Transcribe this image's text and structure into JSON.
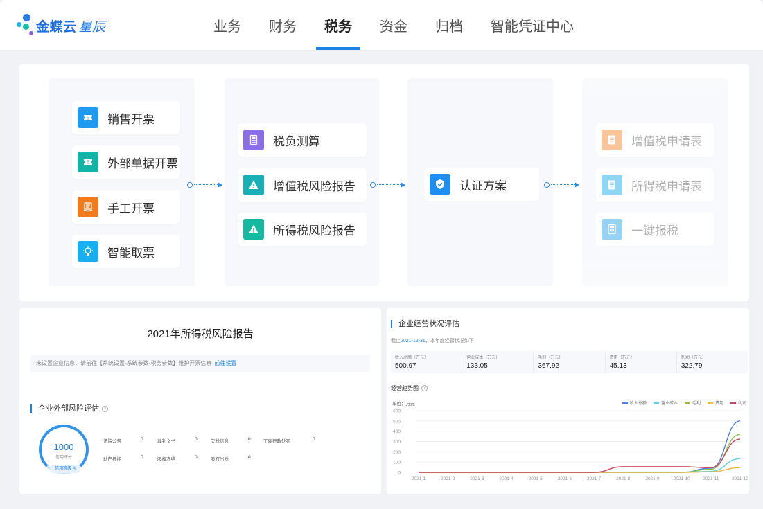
{
  "brand": {
    "name": "金蝶云",
    "suffix": "星辰"
  },
  "nav": [
    {
      "label": "业务",
      "active": false
    },
    {
      "label": "财务",
      "active": false
    },
    {
      "label": "税务",
      "active": true
    },
    {
      "label": "资金",
      "active": false
    },
    {
      "label": "归档",
      "active": false
    },
    {
      "label": "智能凭证中心",
      "active": false
    }
  ],
  "flow": {
    "col1": [
      {
        "label": "销售开票",
        "icon": "ticket-icon",
        "color": "#1e9af1"
      },
      {
        "label": "外部单据开票",
        "icon": "ticket-icon",
        "color": "#13b4a8"
      },
      {
        "label": "手工开票",
        "icon": "hand-invoice-icon",
        "color": "#f27a1a"
      },
      {
        "label": "智能取票",
        "icon": "lightbulb-icon",
        "color": "#18aff0"
      }
    ],
    "col2": [
      {
        "label": "税负测算",
        "icon": "calculator-icon",
        "color": "#8a6ee8"
      },
      {
        "label": "增值税风险报告",
        "icon": "warning-icon",
        "color": "#17b0b6"
      },
      {
        "label": "所得税风险报告",
        "icon": "warning-icon",
        "color": "#14b9a0"
      }
    ],
    "col3": [
      {
        "label": "认证方案",
        "icon": "shield-icon",
        "color": "#1e8ff0"
      }
    ],
    "col4": [
      {
        "label": "增值税申请表",
        "icon": "document-icon",
        "color": "#f6b27a"
      },
      {
        "label": "所得税申请表",
        "icon": "document-icon",
        "color": "#6ac9f2"
      },
      {
        "label": "一键报税",
        "icon": "form-icon",
        "color": "#74c3f0"
      }
    ]
  },
  "risk_report": {
    "title": "2021年所得税风险报告",
    "notice": "未设置企业信息，请前往【系统设置-系统参数-税务参数】维护开票信息",
    "notice_link": "前往设置",
    "section_title": "企业外部风险评估",
    "score": "1000",
    "score_label": "信用评分",
    "grade": "信用等级 A",
    "items_row1": [
      {
        "label": "法院公告",
        "value": "0"
      },
      {
        "label": "裁判文书",
        "value": "0"
      },
      {
        "label": "欠税信息",
        "value": "0"
      },
      {
        "label": "工商行政处罚",
        "value": "0"
      }
    ],
    "items_row2": [
      {
        "label": "动产抵押",
        "value": "0"
      },
      {
        "label": "股权冻结",
        "value": "0"
      },
      {
        "label": "股权出质",
        "value": "0"
      }
    ]
  },
  "business": {
    "section_title": "企业经营状况评估",
    "sub_prefix": "截止",
    "sub_date": "2021-12-31",
    "sub_suffix": "，本年度经营状况如下",
    "metrics": [
      {
        "label": "收入总额（万元）",
        "value": "500.97"
      },
      {
        "label": "营业成本（万元）",
        "value": "133.05"
      },
      {
        "label": "毛利（万元）",
        "value": "367.92"
      },
      {
        "label": "费用（万元）",
        "value": "45.13"
      },
      {
        "label": "利润（万元）",
        "value": "322.79"
      }
    ],
    "trend_title": "经营趋势图",
    "unit": "单位：万元"
  },
  "chart_data": {
    "type": "line",
    "x": [
      "2021-1",
      "2021-2",
      "2021-3",
      "2021-4",
      "2021-5",
      "2021-6",
      "2021-7",
      "2021-8",
      "2021-9",
      "2021-10",
      "2021-11",
      "2021-12"
    ],
    "ylim": [
      0,
      600
    ],
    "yticks": [
      "600",
      "500",
      "400",
      "300",
      "200",
      "100",
      "0"
    ],
    "series": [
      {
        "name": "收入总额",
        "color": "#4a7fe0",
        "values": [
          0,
          0,
          0,
          0,
          0,
          0,
          0,
          0,
          0,
          0,
          40,
          500
        ]
      },
      {
        "name": "营业成本",
        "color": "#5ccfe6",
        "values": [
          0,
          0,
          0,
          0,
          0,
          0,
          0,
          0,
          0,
          0,
          10,
          133
        ]
      },
      {
        "name": "毛利",
        "color": "#8bc34a",
        "values": [
          0,
          0,
          0,
          0,
          0,
          0,
          0,
          0,
          0,
          0,
          30,
          368
        ]
      },
      {
        "name": "费用",
        "color": "#f2b84b",
        "values": [
          0,
          0,
          0,
          0,
          0,
          0,
          0,
          0,
          0,
          0,
          5,
          45
        ]
      },
      {
        "name": "利润",
        "color": "#c94a5f",
        "values": [
          0,
          0,
          0,
          0,
          0,
          0,
          0,
          55,
          55,
          55,
          45,
          323
        ]
      }
    ]
  }
}
